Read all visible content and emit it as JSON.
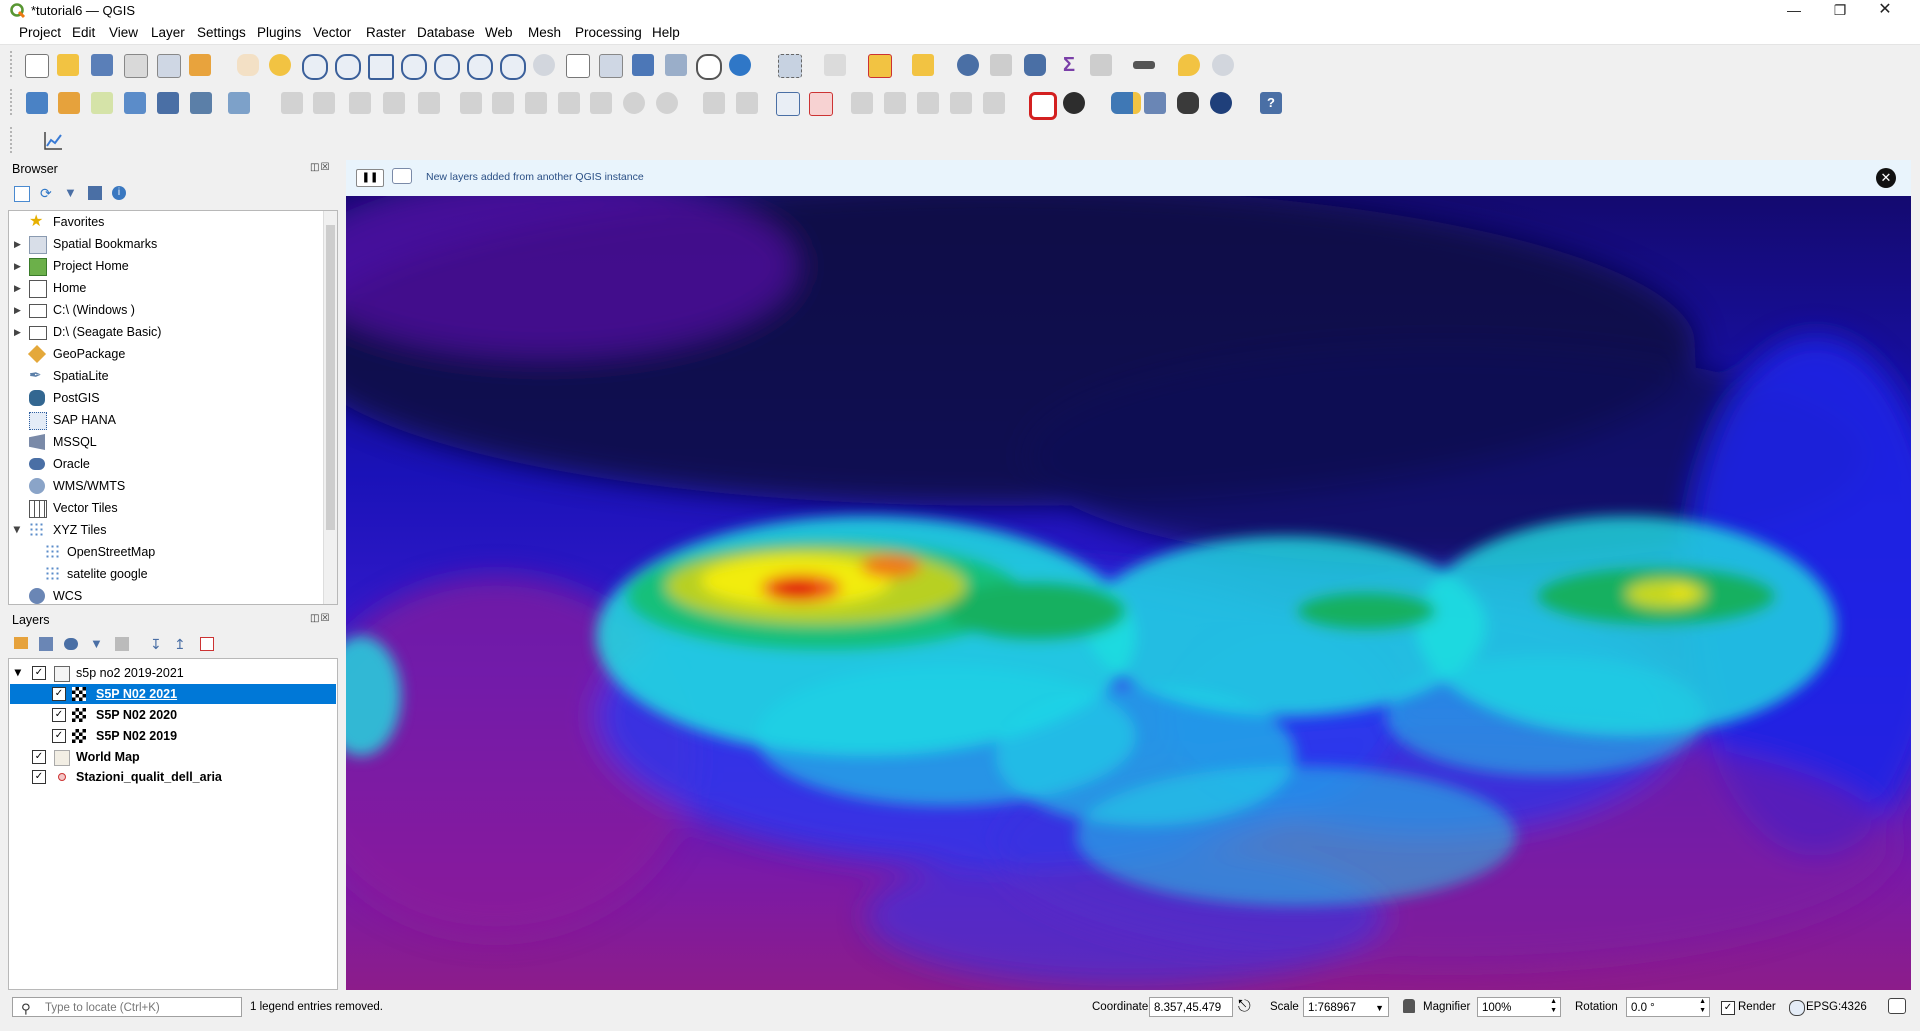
{
  "window": {
    "title": "*tutorial6 — QGIS"
  },
  "menu": [
    "Project",
    "Edit",
    "View",
    "Layer",
    "Settings",
    "Plugins",
    "Vector",
    "Raster",
    "Database",
    "Web",
    "Mesh",
    "Processing",
    "Help"
  ],
  "browser": {
    "title": "Browser",
    "items": [
      {
        "label": "Favorites",
        "icon": "star-icon"
      },
      {
        "label": "Spatial Bookmarks",
        "icon": "bookmark-icon"
      },
      {
        "label": "Project Home",
        "icon": "project-home-icon"
      },
      {
        "label": "Home",
        "icon": "home-folder-icon"
      },
      {
        "label": "C:\\ (Windows )",
        "icon": "drive-icon"
      },
      {
        "label": "D:\\ (Seagate Basic)",
        "icon": "drive-icon"
      },
      {
        "label": "GeoPackage",
        "icon": "geopackage-icon"
      },
      {
        "label": "SpatiaLite",
        "icon": "spatialite-icon"
      },
      {
        "label": "PostGIS",
        "icon": "postgis-icon"
      },
      {
        "label": "SAP HANA",
        "icon": "sap-hana-icon"
      },
      {
        "label": "MSSQL",
        "icon": "mssql-icon"
      },
      {
        "label": "Oracle",
        "icon": "oracle-icon"
      },
      {
        "label": "WMS/WMTS",
        "icon": "wms-icon"
      },
      {
        "label": "Vector Tiles",
        "icon": "vector-tiles-icon"
      },
      {
        "label": "XYZ Tiles",
        "icon": "xyz-tiles-icon"
      },
      {
        "label": "OpenStreetMap",
        "icon": "xyz-tiles-icon"
      },
      {
        "label": "satelite google",
        "icon": "xyz-tiles-icon"
      },
      {
        "label": "WCS",
        "icon": "wcs-icon"
      }
    ]
  },
  "layers": {
    "title": "Layers",
    "group": "s5p no2 2019-2021",
    "rows": [
      {
        "label": "S5P N02 2021",
        "selected": true
      },
      {
        "label": "S5P N02 2020",
        "selected": false
      },
      {
        "label": "S5P N02 2019",
        "selected": false
      },
      {
        "label": "World Map",
        "selected": false
      },
      {
        "label": "Stazioni_qualit_dell_aria",
        "selected": false
      }
    ]
  },
  "message": "New layers added from another QGIS instance",
  "status": {
    "locator_placeholder": "Type to locate (Ctrl+K)",
    "message": "1 legend entries removed.",
    "coordinate_label": "Coordinate",
    "coordinate": "8.357,45.479",
    "scale_label": "Scale",
    "scale": "1:768967",
    "magnifier_label": "Magnifier",
    "magnifier": "100%",
    "rotation_label": "Rotation",
    "rotation": "0.0 °",
    "render_label": "Render",
    "crs": "EPSG:4326"
  }
}
